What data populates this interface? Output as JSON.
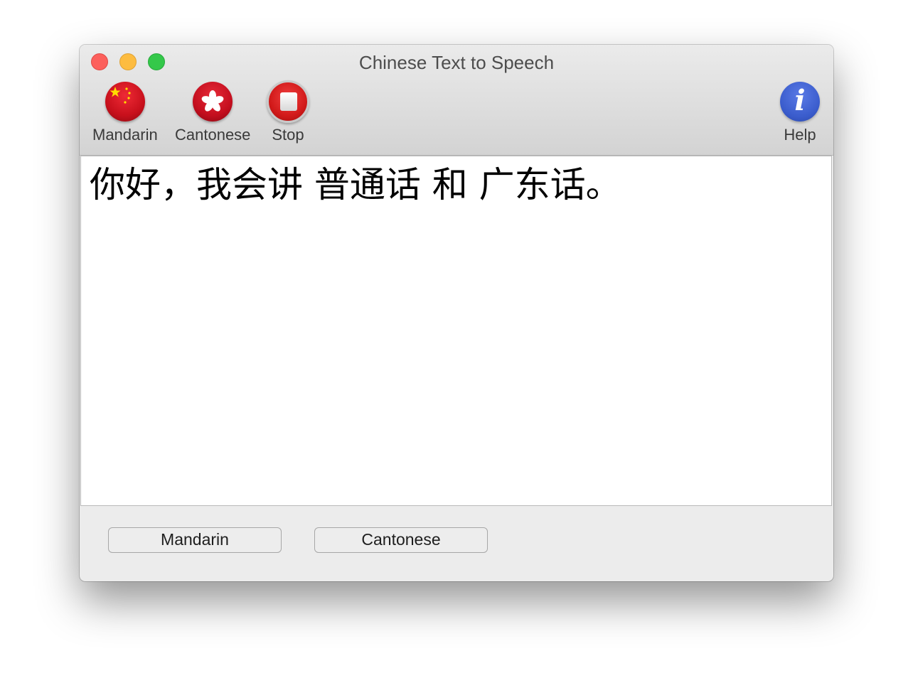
{
  "window": {
    "title": "Chinese Text to Speech"
  },
  "toolbar": {
    "items": [
      {
        "label": "Mandarin",
        "icon": "china-flag-icon"
      },
      {
        "label": "Cantonese",
        "icon": "hong-kong-flag-icon"
      },
      {
        "label": "Stop",
        "icon": "stop-icon"
      },
      {
        "label": "Help",
        "icon": "info-icon"
      }
    ],
    "help_glyph": "i"
  },
  "editor": {
    "text": "你好，我会讲 普通话 和 广东话。"
  },
  "footer": {
    "buttons": [
      {
        "label": "Mandarin"
      },
      {
        "label": "Cantonese"
      }
    ]
  },
  "colors": {
    "close": "#fc605c",
    "minimize": "#fdbc40",
    "maximize": "#34c84a",
    "flag_red": "#de2910",
    "flag_yellow": "#ffde00",
    "help_blue": "#3a5ccc"
  }
}
